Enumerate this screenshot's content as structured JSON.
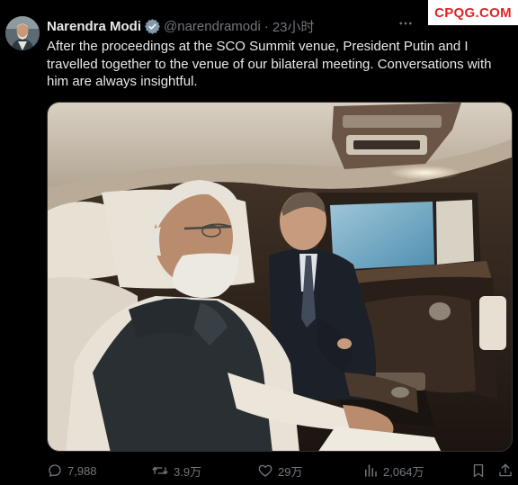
{
  "author": {
    "name": "Narendra Modi",
    "handle": "@narendramodi",
    "separator": "·",
    "time": "23小时",
    "verified": true,
    "verified_color": "#829aab"
  },
  "watermark": {
    "text": "CPQG.COM",
    "color": "#e02424"
  },
  "tweet": {
    "text": "After the proceedings at the SCO Summit venue, President Putin and I travelled together to the venue of our bilateral meeting. Conversations with him are always insightful."
  },
  "media": {
    "description": "photo"
  },
  "actions": {
    "reply_count": "7,988",
    "retweet_count": "3.9万",
    "like_count": "29万",
    "view_count": "2,064万"
  },
  "icons": {
    "more": "more-icon",
    "reply": "reply-icon",
    "retweet": "retweet-icon",
    "like": "heart-icon",
    "views": "views-icon",
    "bookmark": "bookmark-icon",
    "share": "share-icon"
  },
  "colors": {
    "background": "#000000",
    "text": "#e7e9ea",
    "muted": "#71767b"
  }
}
